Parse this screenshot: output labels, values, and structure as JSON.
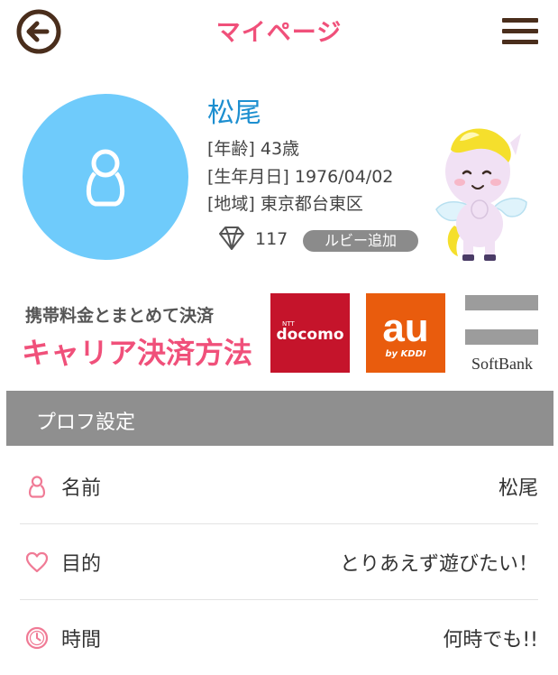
{
  "header": {
    "title": "マイページ",
    "back_icon": "arrow-left-circle-icon",
    "menu_icon": "hamburger-menu-icon"
  },
  "profile": {
    "name": "松尾",
    "age_line": "[年齢] 43歳",
    "birthday_line": "[生年月日] 1976/04/02",
    "region_line": "[地域] 東京都台東区",
    "ruby_count": "117",
    "ruby_button": "ルビー追加"
  },
  "banner": {
    "subtitle": "携帯料金とまとめて決済",
    "title": "キャリア決済方法",
    "carriers": {
      "docomo_top": "NTT",
      "docomo": "docomo",
      "au": "au",
      "au_sub": "by KDDI",
      "softbank": "SoftBank"
    }
  },
  "section": {
    "title": "プロフ設定"
  },
  "rows": [
    {
      "icon": "person-icon",
      "label": "名前",
      "value": "松尾"
    },
    {
      "icon": "heart-icon",
      "label": "目的",
      "value": "とりあえず遊びたい！"
    },
    {
      "icon": "clock-icon",
      "label": "時間",
      "value": "何時でも!!"
    }
  ],
  "colors": {
    "accent_pink": "#f0507a",
    "name_blue": "#1d8fd0",
    "avatar_blue": "#6fcbfb",
    "header_brown": "#4a2e1c",
    "section_gray": "#8f8f8f"
  }
}
